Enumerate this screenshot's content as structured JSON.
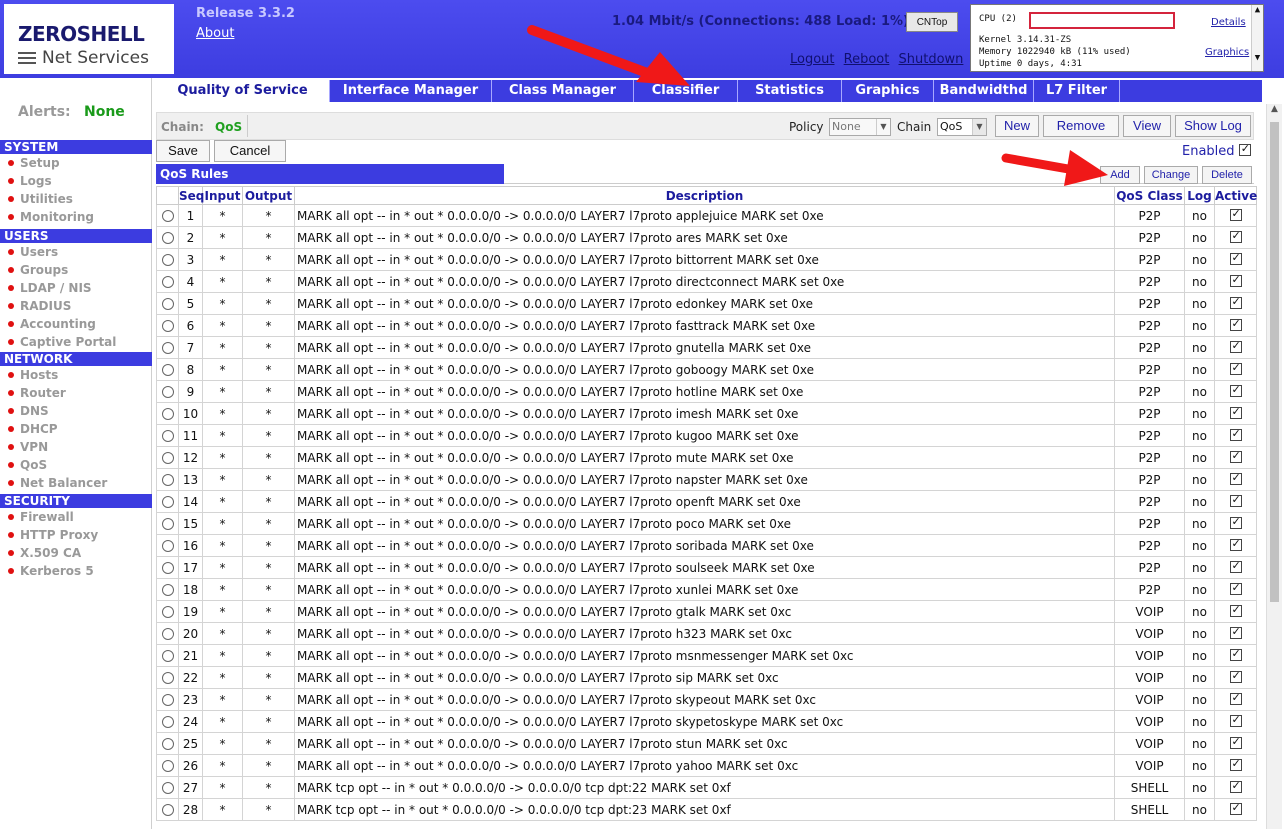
{
  "header": {
    "logo_title": "ZEROSHELL",
    "logo_sub": "Net Services",
    "release": "Release 3.3.2",
    "about": "About",
    "traffic": "1.04 Mbit/s (Connections: 488 Load: 1%)",
    "cntop": "CNTop",
    "links": {
      "logout": "Logout",
      "reboot": "Reboot",
      "shutdown": "Shutdown"
    },
    "sys": {
      "cpu": "CPU (2)",
      "kernel": "Kernel  3.14.31-ZS",
      "memory": "Memory  1022940 kB (11% used)",
      "uptime": "Uptime  0 days, 4:31",
      "details": "Details",
      "graphics": "Graphics"
    }
  },
  "tabs": [
    "Quality of Service",
    "Interface Manager",
    "Class Manager",
    "Classifier",
    "Statistics",
    "Graphics",
    "Bandwidthd",
    "L7 Filter"
  ],
  "sidebar": {
    "alerts_label": "Alerts:",
    "alerts_value": "None",
    "sections": [
      {
        "title": "SYSTEM",
        "items": [
          "Setup",
          "Logs",
          "Utilities",
          "Monitoring"
        ]
      },
      {
        "title": "USERS",
        "items": [
          "Users",
          "Groups",
          "LDAP / NIS",
          "RADIUS",
          "Accounting",
          "Captive Portal"
        ]
      },
      {
        "title": "NETWORK",
        "items": [
          "Hosts",
          "Router",
          "DNS",
          "DHCP",
          "VPN",
          "QoS",
          "Net Balancer"
        ]
      },
      {
        "title": "SECURITY",
        "items": [
          "Firewall",
          "HTTP Proxy",
          "X.509 CA",
          "Kerberos 5"
        ]
      }
    ]
  },
  "toolbar": {
    "chain_label": "Chain:",
    "chain_value": "QoS",
    "policy_label": "Policy",
    "policy_value": "None",
    "chain_select_label": "Chain",
    "chain_select_value": "QoS",
    "new": "New",
    "remove": "Remove",
    "view": "View",
    "showlog": "Show Log",
    "save": "Save",
    "cancel": "Cancel",
    "enabled": "Enabled"
  },
  "rules_panel": {
    "title": "QoS Rules",
    "add": "Add",
    "change": "Change",
    "delete": "Delete",
    "columns": [
      "Seq",
      "Input",
      "Output",
      "Description",
      "QoS Class",
      "Log",
      "Active"
    ]
  },
  "rules": [
    {
      "seq": "1",
      "input": "*",
      "output": "*",
      "desc": "MARK all opt -- in * out * 0.0.0.0/0 -> 0.0.0.0/0 LAYER7 l7proto applejuice MARK set 0xe",
      "cls": "P2P",
      "log": "no"
    },
    {
      "seq": "2",
      "input": "*",
      "output": "*",
      "desc": "MARK all opt -- in * out * 0.0.0.0/0 -> 0.0.0.0/0 LAYER7 l7proto ares MARK set 0xe",
      "cls": "P2P",
      "log": "no"
    },
    {
      "seq": "3",
      "input": "*",
      "output": "*",
      "desc": "MARK all opt -- in * out * 0.0.0.0/0 -> 0.0.0.0/0 LAYER7 l7proto bittorrent MARK set 0xe",
      "cls": "P2P",
      "log": "no"
    },
    {
      "seq": "4",
      "input": "*",
      "output": "*",
      "desc": "MARK all opt -- in * out * 0.0.0.0/0 -> 0.0.0.0/0 LAYER7 l7proto directconnect MARK set 0xe",
      "cls": "P2P",
      "log": "no"
    },
    {
      "seq": "5",
      "input": "*",
      "output": "*",
      "desc": "MARK all opt -- in * out * 0.0.0.0/0 -> 0.0.0.0/0 LAYER7 l7proto edonkey MARK set 0xe",
      "cls": "P2P",
      "log": "no"
    },
    {
      "seq": "6",
      "input": "*",
      "output": "*",
      "desc": "MARK all opt -- in * out * 0.0.0.0/0 -> 0.0.0.0/0 LAYER7 l7proto fasttrack MARK set 0xe",
      "cls": "P2P",
      "log": "no"
    },
    {
      "seq": "7",
      "input": "*",
      "output": "*",
      "desc": "MARK all opt -- in * out * 0.0.0.0/0 -> 0.0.0.0/0 LAYER7 l7proto gnutella MARK set 0xe",
      "cls": "P2P",
      "log": "no"
    },
    {
      "seq": "8",
      "input": "*",
      "output": "*",
      "desc": "MARK all opt -- in * out * 0.0.0.0/0 -> 0.0.0.0/0 LAYER7 l7proto goboogy MARK set 0xe",
      "cls": "P2P",
      "log": "no"
    },
    {
      "seq": "9",
      "input": "*",
      "output": "*",
      "desc": "MARK all opt -- in * out * 0.0.0.0/0 -> 0.0.0.0/0 LAYER7 l7proto hotline MARK set 0xe",
      "cls": "P2P",
      "log": "no"
    },
    {
      "seq": "10",
      "input": "*",
      "output": "*",
      "desc": "MARK all opt -- in * out * 0.0.0.0/0 -> 0.0.0.0/0 LAYER7 l7proto imesh MARK set 0xe",
      "cls": "P2P",
      "log": "no"
    },
    {
      "seq": "11",
      "input": "*",
      "output": "*",
      "desc": "MARK all opt -- in * out * 0.0.0.0/0 -> 0.0.0.0/0 LAYER7 l7proto kugoo MARK set 0xe",
      "cls": "P2P",
      "log": "no"
    },
    {
      "seq": "12",
      "input": "*",
      "output": "*",
      "desc": "MARK all opt -- in * out * 0.0.0.0/0 -> 0.0.0.0/0 LAYER7 l7proto mute MARK set 0xe",
      "cls": "P2P",
      "log": "no"
    },
    {
      "seq": "13",
      "input": "*",
      "output": "*",
      "desc": "MARK all opt -- in * out * 0.0.0.0/0 -> 0.0.0.0/0 LAYER7 l7proto napster MARK set 0xe",
      "cls": "P2P",
      "log": "no"
    },
    {
      "seq": "14",
      "input": "*",
      "output": "*",
      "desc": "MARK all opt -- in * out * 0.0.0.0/0 -> 0.0.0.0/0 LAYER7 l7proto openft MARK set 0xe",
      "cls": "P2P",
      "log": "no"
    },
    {
      "seq": "15",
      "input": "*",
      "output": "*",
      "desc": "MARK all opt -- in * out * 0.0.0.0/0 -> 0.0.0.0/0 LAYER7 l7proto poco MARK set 0xe",
      "cls": "P2P",
      "log": "no"
    },
    {
      "seq": "16",
      "input": "*",
      "output": "*",
      "desc": "MARK all opt -- in * out * 0.0.0.0/0 -> 0.0.0.0/0 LAYER7 l7proto soribada MARK set 0xe",
      "cls": "P2P",
      "log": "no"
    },
    {
      "seq": "17",
      "input": "*",
      "output": "*",
      "desc": "MARK all opt -- in * out * 0.0.0.0/0 -> 0.0.0.0/0 LAYER7 l7proto soulseek MARK set 0xe",
      "cls": "P2P",
      "log": "no"
    },
    {
      "seq": "18",
      "input": "*",
      "output": "*",
      "desc": "MARK all opt -- in * out * 0.0.0.0/0 -> 0.0.0.0/0 LAYER7 l7proto xunlei MARK set 0xe",
      "cls": "P2P",
      "log": "no"
    },
    {
      "seq": "19",
      "input": "*",
      "output": "*",
      "desc": "MARK all opt -- in * out * 0.0.0.0/0 -> 0.0.0.0/0 LAYER7 l7proto gtalk MARK set 0xc",
      "cls": "VOIP",
      "log": "no"
    },
    {
      "seq": "20",
      "input": "*",
      "output": "*",
      "desc": "MARK all opt -- in * out * 0.0.0.0/0 -> 0.0.0.0/0 LAYER7 l7proto h323 MARK set 0xc",
      "cls": "VOIP",
      "log": "no"
    },
    {
      "seq": "21",
      "input": "*",
      "output": "*",
      "desc": "MARK all opt -- in * out * 0.0.0.0/0 -> 0.0.0.0/0 LAYER7 l7proto msnmessenger MARK set 0xc",
      "cls": "VOIP",
      "log": "no"
    },
    {
      "seq": "22",
      "input": "*",
      "output": "*",
      "desc": "MARK all opt -- in * out * 0.0.0.0/0 -> 0.0.0.0/0 LAYER7 l7proto sip MARK set 0xc",
      "cls": "VOIP",
      "log": "no"
    },
    {
      "seq": "23",
      "input": "*",
      "output": "*",
      "desc": "MARK all opt -- in * out * 0.0.0.0/0 -> 0.0.0.0/0 LAYER7 l7proto skypeout MARK set 0xc",
      "cls": "VOIP",
      "log": "no"
    },
    {
      "seq": "24",
      "input": "*",
      "output": "*",
      "desc": "MARK all opt -- in * out * 0.0.0.0/0 -> 0.0.0.0/0 LAYER7 l7proto skypetoskype MARK set 0xc",
      "cls": "VOIP",
      "log": "no"
    },
    {
      "seq": "25",
      "input": "*",
      "output": "*",
      "desc": "MARK all opt -- in * out * 0.0.0.0/0 -> 0.0.0.0/0 LAYER7 l7proto stun MARK set 0xc",
      "cls": "VOIP",
      "log": "no"
    },
    {
      "seq": "26",
      "input": "*",
      "output": "*",
      "desc": "MARK all opt -- in * out * 0.0.0.0/0 -> 0.0.0.0/0 LAYER7 l7proto yahoo MARK set 0xc",
      "cls": "VOIP",
      "log": "no"
    },
    {
      "seq": "27",
      "input": "*",
      "output": "*",
      "desc": "MARK tcp opt -- in * out * 0.0.0.0/0 -> 0.0.0.0/0 tcp dpt:22 MARK set 0xf",
      "cls": "SHELL",
      "log": "no"
    },
    {
      "seq": "28",
      "input": "*",
      "output": "*",
      "desc": "MARK tcp opt -- in * out * 0.0.0.0/0 -> 0.0.0.0/0 tcp dpt:23 MARK set 0xf",
      "cls": "SHELL",
      "log": "no"
    }
  ],
  "colors": {
    "header_blue": "#3c3ce0",
    "link_blue": "#2222aa",
    "ok_green": "#1a9a1a",
    "bullet_red": "#e01010",
    "arrow_red": "#f01818"
  },
  "icons": {
    "scroll_up": "chevron-up-icon",
    "select_arrow": "chevron-down-icon",
    "checkbox": "checkbox-icon",
    "radio": "radio-icon"
  }
}
